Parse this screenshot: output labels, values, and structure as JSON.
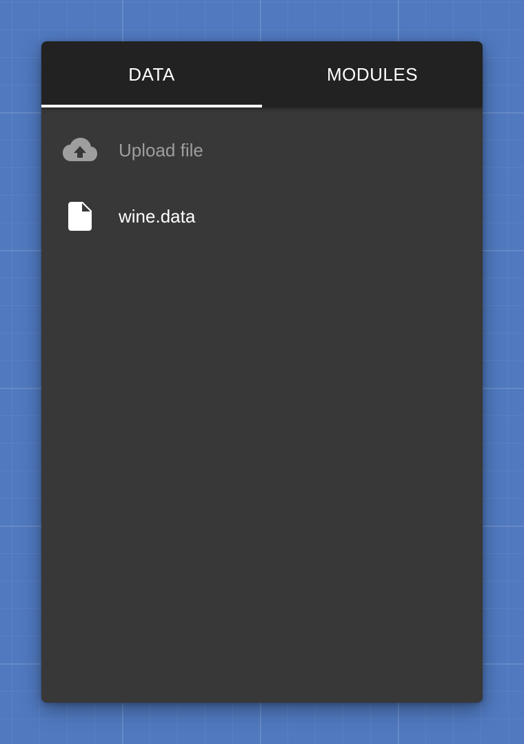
{
  "tabs": [
    {
      "label": "DATA",
      "active": true
    },
    {
      "label": "MODULES",
      "active": false
    }
  ],
  "data_panel": {
    "upload": {
      "label": "Upload file",
      "icon": "cloud-upload-icon"
    },
    "files": [
      {
        "name": "wine.data",
        "icon": "file-icon"
      }
    ]
  },
  "colors": {
    "background": "#5079bf",
    "panel": "#383838",
    "tabbar": "#222222",
    "indicator": "#ffffff",
    "muted_text": "#9e9e9e"
  }
}
